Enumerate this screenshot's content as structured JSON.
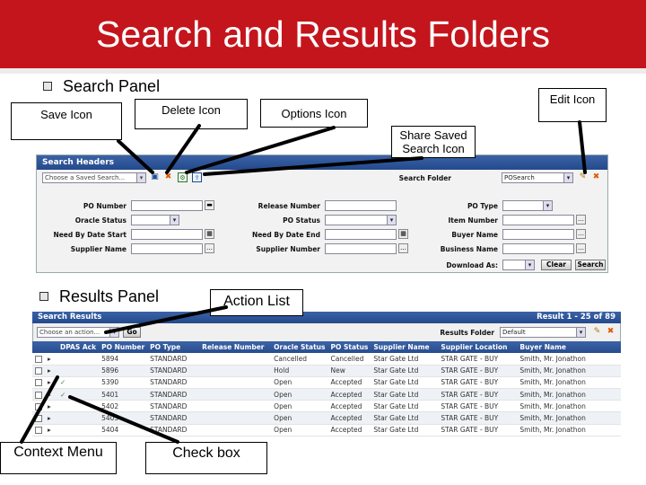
{
  "slide": {
    "title": "Search and Results Folders",
    "bullet_search": "Search Panel",
    "bullet_results": "Results Panel"
  },
  "callouts": {
    "save_icon": "Save Icon",
    "delete_icon": "Delete Icon",
    "options_icon": "Options Icon",
    "edit_icon": "Edit Icon",
    "share_saved_search_icon": "Share Saved Search Icon",
    "action_list": "Action List",
    "context_menu": "Context Menu",
    "check_box": "Check box"
  },
  "search_panel": {
    "header": "Search Headers",
    "saved_search_placeholder": "Choose a Saved Search...",
    "search_folder_label": "Search Folder",
    "search_folder_value": "POSearch",
    "fields": [
      {
        "label": "PO Number",
        "value": ""
      },
      {
        "label": "Oracle Status",
        "value": ""
      },
      {
        "label": "Need By Date Start",
        "value": ""
      },
      {
        "label": "Supplier Name",
        "value": ""
      },
      {
        "label": "Release Number",
        "value": ""
      },
      {
        "label": "PO Status",
        "value": ""
      },
      {
        "label": "Need By Date End",
        "value": ""
      },
      {
        "label": "Supplier Number",
        "value": ""
      },
      {
        "label": "PO Type",
        "value": ""
      },
      {
        "label": "Item Number",
        "value": ""
      },
      {
        "label": "Buyer Name",
        "value": ""
      },
      {
        "label": "Business Name",
        "value": ""
      }
    ],
    "download_as_label": "Download As:",
    "clear_label": "Clear",
    "search_label": "Search"
  },
  "results_panel": {
    "header": "Search Results",
    "results_folder_label": "Results Folder",
    "results_folder_value": "Default",
    "result_count": "Result 1 - 25 of 89",
    "action_placeholder": "Choose an action...",
    "go_label": "Go",
    "columns": [
      "",
      "",
      "DPAS Ack",
      "PO Number",
      "PO Type",
      "Release Number",
      "Oracle Status",
      "PO Status",
      "Supplier Name",
      "Supplier Location",
      "Buyer Name"
    ],
    "rows": [
      {
        "ack": "",
        "po": "5894",
        "type": "STANDARD",
        "release": "",
        "oracle": "Cancelled",
        "status": "Cancelled",
        "supplier": "Star Gate Ltd",
        "location": "STAR GATE - BUY",
        "buyer": "Smith, Mr. Jonathon"
      },
      {
        "ack": "",
        "po": "5896",
        "type": "STANDARD",
        "release": "",
        "oracle": "Hold",
        "status": "New",
        "supplier": "Star Gate Ltd",
        "location": "STAR GATE - BUY",
        "buyer": "Smith, Mr. Jonathon"
      },
      {
        "ack": "✓",
        "po": "5390",
        "type": "STANDARD",
        "release": "",
        "oracle": "Open",
        "status": "Accepted",
        "supplier": "Star Gate Ltd",
        "location": "STAR GATE - BUY",
        "buyer": "Smith, Mr. Jonathon"
      },
      {
        "ack": "✓",
        "po": "5401",
        "type": "STANDARD",
        "release": "",
        "oracle": "Open",
        "status": "Accepted",
        "supplier": "Star Gate Ltd",
        "location": "STAR GATE - BUY",
        "buyer": "Smith, Mr. Jonathon"
      },
      {
        "ack": "",
        "po": "5402",
        "type": "STANDARD",
        "release": "",
        "oracle": "Open",
        "status": "Accepted",
        "supplier": "Star Gate Ltd",
        "location": "STAR GATE - BUY",
        "buyer": "Smith, Mr. Jonathon"
      },
      {
        "ack": "",
        "po": "5403",
        "type": "STANDARD",
        "release": "",
        "oracle": "Open",
        "status": "Accepted",
        "supplier": "Star Gate Ltd",
        "location": "STAR GATE - BUY",
        "buyer": "Smith, Mr. Jonathon"
      },
      {
        "ack": "",
        "po": "5404",
        "type": "STANDARD",
        "release": "",
        "oracle": "Open",
        "status": "Accepted",
        "supplier": "Star Gate Ltd",
        "location": "STAR GATE - BUY",
        "buyer": "Smith, Mr. Jonathon"
      }
    ]
  },
  "colors": {
    "title_bg": "#c4151c",
    "header_blue": "#2f5597"
  }
}
